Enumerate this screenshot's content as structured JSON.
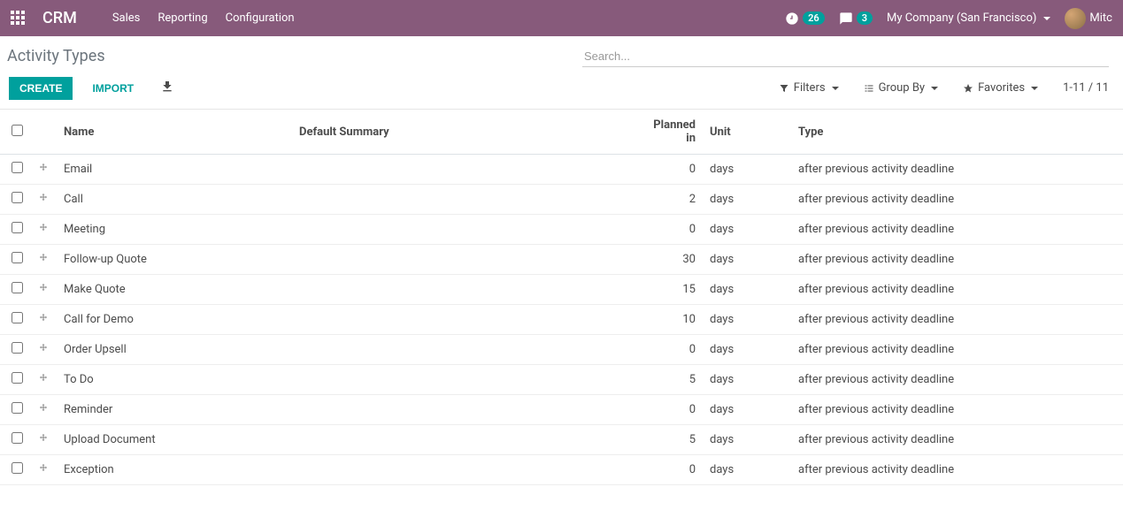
{
  "navbar": {
    "brand": "CRM",
    "menu": [
      "Sales",
      "Reporting",
      "Configuration"
    ],
    "clock_badge": "26",
    "chat_badge": "3",
    "company": "My Company (San Francisco)",
    "username": "Mitc"
  },
  "breadcrumb": "Activity Types",
  "search": {
    "placeholder": "Search..."
  },
  "buttons": {
    "create": "CREATE",
    "import": "IMPORT"
  },
  "filter_bar": {
    "filters": "Filters",
    "group_by": "Group By",
    "favorites": "Favorites"
  },
  "pager": "1-11 / 11",
  "columns": {
    "name": "Name",
    "summary": "Default Summary",
    "planned": "Planned in",
    "unit": "Unit",
    "type": "Type"
  },
  "rows": [
    {
      "name": "Email",
      "summary": "",
      "planned": "0",
      "unit": "days",
      "type": "after previous activity deadline"
    },
    {
      "name": "Call",
      "summary": "",
      "planned": "2",
      "unit": "days",
      "type": "after previous activity deadline"
    },
    {
      "name": "Meeting",
      "summary": "",
      "planned": "0",
      "unit": "days",
      "type": "after previous activity deadline"
    },
    {
      "name": "Follow-up Quote",
      "summary": "",
      "planned": "30",
      "unit": "days",
      "type": "after previous activity deadline"
    },
    {
      "name": "Make Quote",
      "summary": "",
      "planned": "15",
      "unit": "days",
      "type": "after previous activity deadline"
    },
    {
      "name": "Call for Demo",
      "summary": "",
      "planned": "10",
      "unit": "days",
      "type": "after previous activity deadline"
    },
    {
      "name": "Order Upsell",
      "summary": "",
      "planned": "0",
      "unit": "days",
      "type": "after previous activity deadline"
    },
    {
      "name": "To Do",
      "summary": "",
      "planned": "5",
      "unit": "days",
      "type": "after previous activity deadline"
    },
    {
      "name": "Reminder",
      "summary": "",
      "planned": "0",
      "unit": "days",
      "type": "after previous activity deadline"
    },
    {
      "name": "Upload Document",
      "summary": "",
      "planned": "5",
      "unit": "days",
      "type": "after previous activity deadline"
    },
    {
      "name": "Exception",
      "summary": "",
      "planned": "0",
      "unit": "days",
      "type": "after previous activity deadline"
    }
  ]
}
